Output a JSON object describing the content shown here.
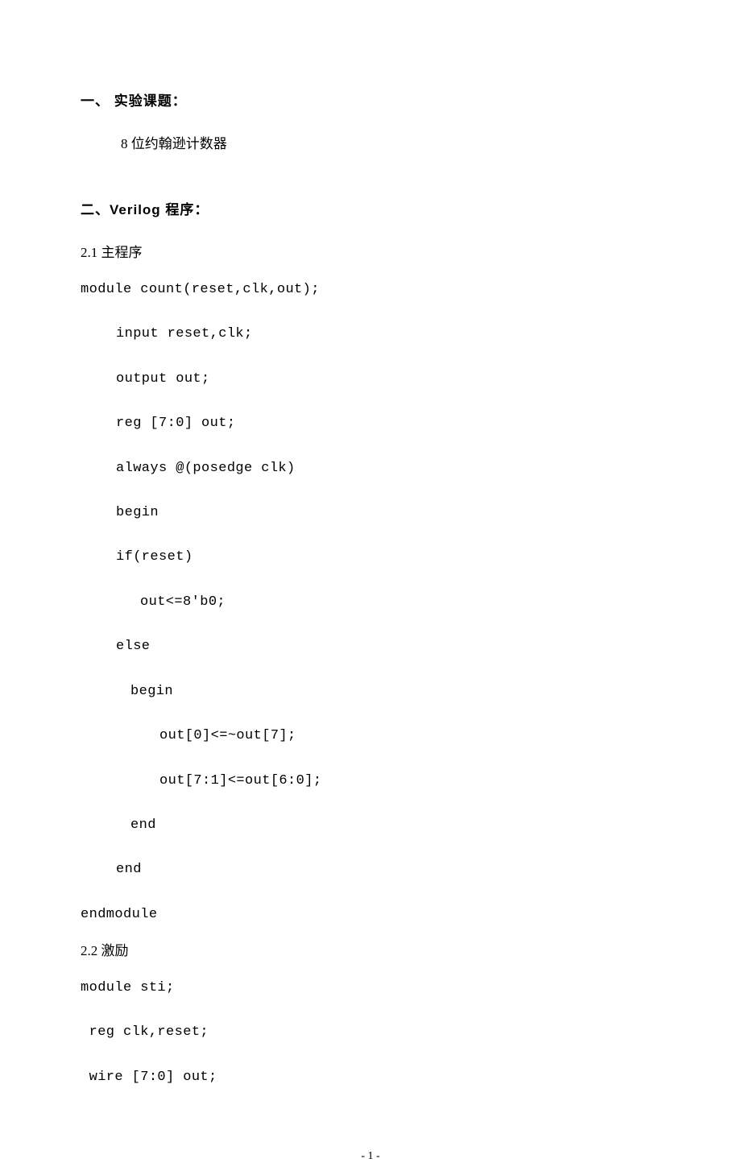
{
  "section1": {
    "heading": "一、  实验课题：",
    "content": "8 位约翰逊计数器"
  },
  "section2": {
    "heading": "二、Verilog 程序：",
    "sub1": "2.1 主程序",
    "code1": [
      "module count(reset,clk,out);",
      "input reset,clk;",
      "output out;",
      "reg [7:0] out;",
      "always @(posedge clk)",
      "begin",
      "if(reset)",
      "out<=8'b0;",
      "else",
      "begin",
      "out[0]<=~out[7];",
      "out[7:1]<=out[6:0];",
      "end",
      "end",
      "endmodule"
    ],
    "sub2": "2.2 激励",
    "code2": [
      "module sti;",
      " reg clk,reset;",
      " wire [7:0] out;"
    ]
  },
  "pagenum": "- 1 -"
}
